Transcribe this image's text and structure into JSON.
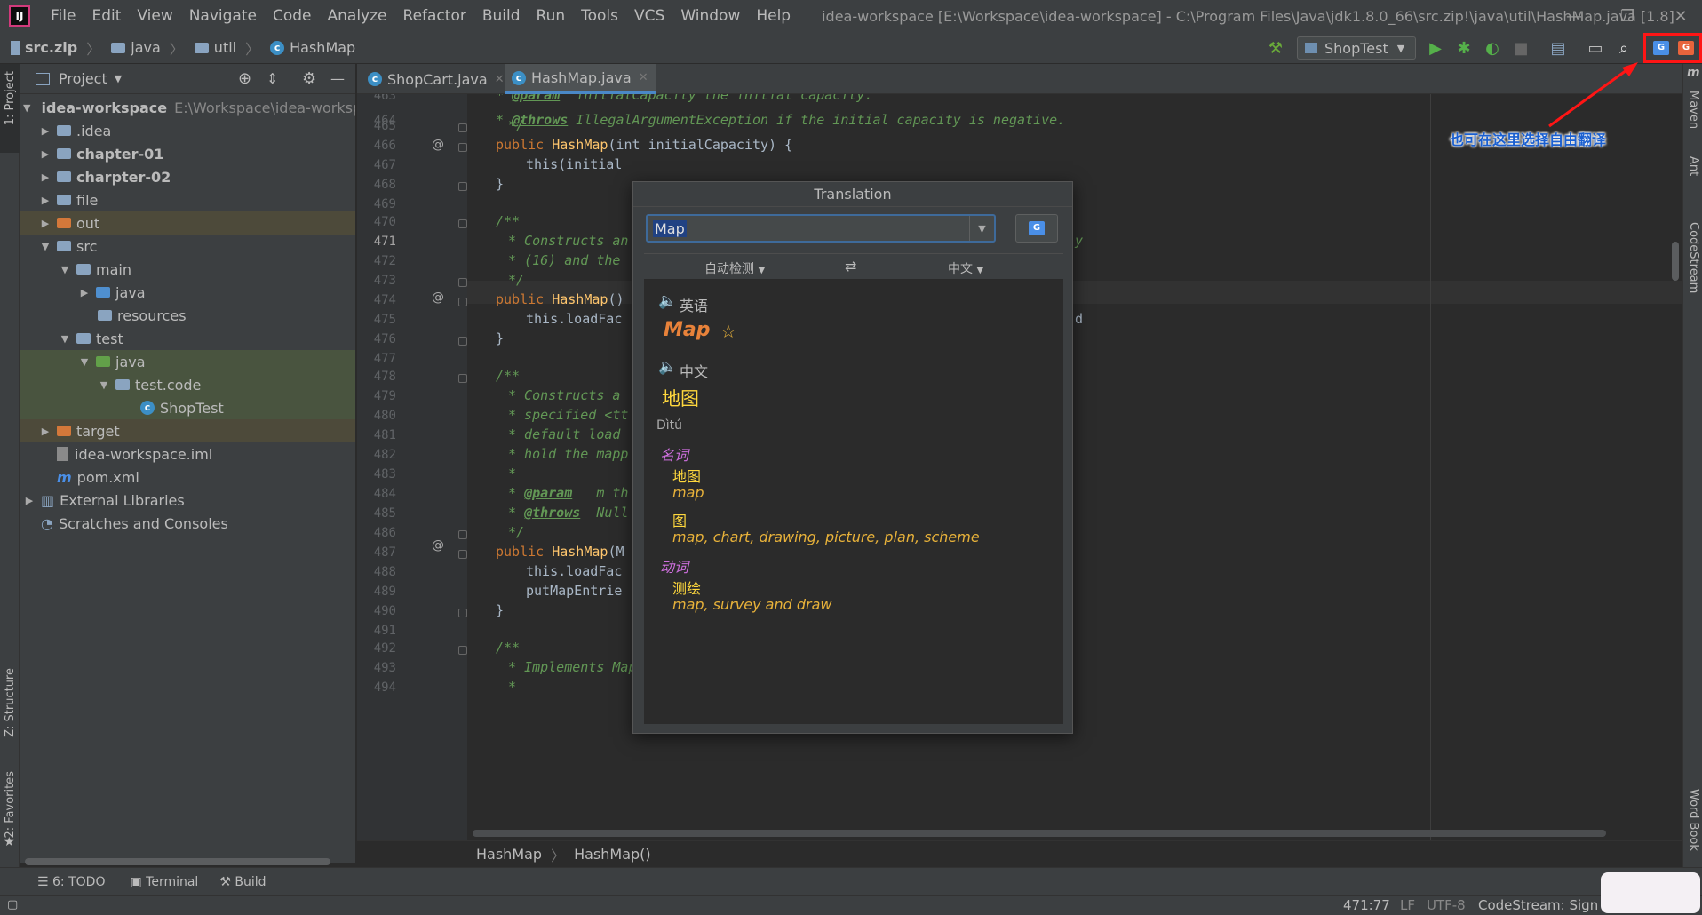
{
  "menubar": {
    "items": [
      "File",
      "Edit",
      "View",
      "Navigate",
      "Code",
      "Analyze",
      "Refactor",
      "Build",
      "Run",
      "Tools",
      "VCS",
      "Window",
      "Help"
    ],
    "window_title": "idea-workspace [E:\\Workspace\\idea-workspace] - C:\\Program Files\\Java\\jdk1.8.0_66\\src.zip!\\java\\util\\HashMap.java [1.8]"
  },
  "navbar": {
    "crumbs": [
      "src.zip",
      "java",
      "util",
      "HashMap"
    ],
    "run_config": "ShopTest"
  },
  "left_stripe": {
    "project": "1: Project",
    "structure": "Z: Structure",
    "favorites": "2: Favorites"
  },
  "right_stripe": {
    "maven": "Maven",
    "ant": "Ant",
    "codestream": "CodeStream",
    "wordbook": "Word Book"
  },
  "project_panel": {
    "title": "Project",
    "tree": [
      {
        "label": "idea-workspace",
        "extra": "E:\\Workspace\\idea-worksp"
      },
      {
        "label": ".idea"
      },
      {
        "label": "chapter-01"
      },
      {
        "label": "charpter-02"
      },
      {
        "label": "file"
      },
      {
        "label": "out"
      },
      {
        "label": "src"
      },
      {
        "label": "main"
      },
      {
        "label": "java"
      },
      {
        "label": "resources"
      },
      {
        "label": "test"
      },
      {
        "label": "java"
      },
      {
        "label": "test.code"
      },
      {
        "label": "ShopTest"
      },
      {
        "label": "target"
      },
      {
        "label": "idea-workspace.iml"
      },
      {
        "label": "pom.xml"
      },
      {
        "label": "External Libraries"
      },
      {
        "label": "Scratches and Consoles"
      }
    ]
  },
  "editor_tabs": [
    "ShopCart.java",
    "HashMap.java"
  ],
  "editor": {
    "line_numbers": [
      "463",
      "464",
      "465",
      "466",
      "467",
      "468",
      "469",
      "470",
      "471",
      "472",
      "473",
      "474",
      "475",
      "476",
      "477",
      "478",
      "479",
      "480",
      "481",
      "482",
      "483",
      "484",
      "485",
      "486",
      "487",
      "488",
      "489",
      "490",
      "491",
      "492",
      "493",
      "494"
    ],
    "lines": {
      "l463_tag": "@param",
      "l463_rest": "  initialCapacity the initial capacity.",
      "l464_tag": "@throws",
      "l464_rest": " IllegalArgumentException if the initial capacity is negative.",
      "l465": "*/",
      "l466_kw": "public ",
      "l466_fn": "HashMap",
      "l466_rest": "(int initialCapacity) {",
      "l467": "this(initial",
      "l468": "}",
      "l470": "/**",
      "l471a": "* Constructs an",
      "l471b": "y",
      "l472": "* (16) and the",
      "l473": "*/",
      "l474_kw": "public ",
      "l474_fn": "HashMap",
      "l474_rest": "()",
      "l475": "this.loadFac",
      "l475b": "d",
      "l476": "}",
      "l478": "/**",
      "l479": "* Constructs a",
      "l480": "* specified <tt",
      "l481": "* default load",
      "l482": "* hold the mapp",
      "l483": "*",
      "l484_tag": "@param",
      "l484_rest": "   m th",
      "l485_tag": "@throws",
      "l485_rest": "  Null",
      "l486": "*/",
      "l487_kw": "public ",
      "l487_fn": "HashMap",
      "l487_rest": "(M",
      "l488": "this.loadFac",
      "l489": "putMapEntrie",
      "l490": "}",
      "l492": "/**",
      "l493": "* Implements Map.putAll and Map constructor",
      "l494": "*"
    }
  },
  "breadcrumbs": [
    "HashMap",
    "HashMap()"
  ],
  "translation_popup": {
    "title": "Translation",
    "input_value": "Map",
    "source_lang": "自动检测",
    "target_lang": "中文",
    "swap_icon": "⇄",
    "src_lang_label": "英语",
    "src_word": "Map",
    "tgt_lang_label": "中文",
    "tgt_word": "地图",
    "pinyin": "Dìtú",
    "pos1": "名词",
    "pos1_w1": "地图",
    "pos1_w1_back": "map",
    "pos1_w2": "图",
    "pos1_w2_back": "map, chart, drawing, picture, plan, scheme",
    "pos2": "动词",
    "pos2_w1": "测绘",
    "pos2_w1_back": "map, survey and draw",
    "colors": {
      "src_word": "#e8823a",
      "pos": "#d070e0",
      "tgt": "#ffd83d",
      "back": "#e8b23a"
    }
  },
  "annotation": "也可在这里选择自由翻译",
  "toolwindows": {
    "todo": "6: TODO",
    "terminal": "Terminal",
    "build": "Build"
  },
  "status": {
    "position": "471:77",
    "line_sep": "LF",
    "encoding": "UTF-8",
    "codestream": "CodeStream: Sign i"
  }
}
